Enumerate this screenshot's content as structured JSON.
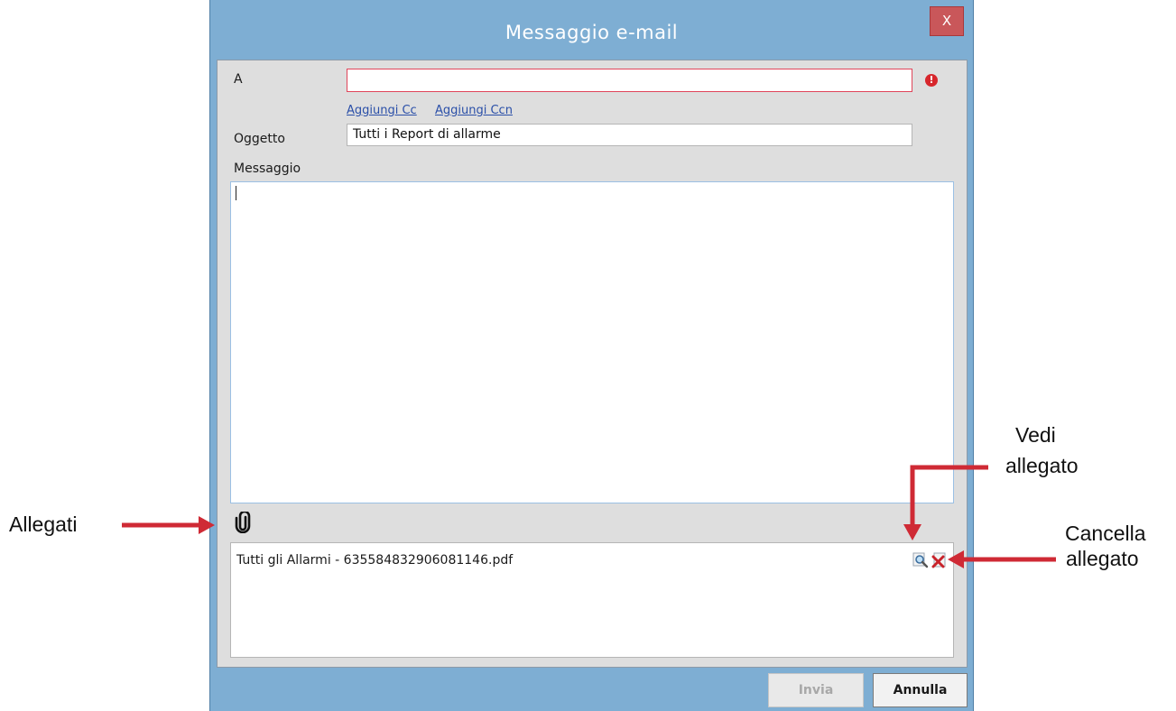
{
  "window": {
    "title": "Messaggio e-mail",
    "close_label": "X"
  },
  "form": {
    "to_label": "A",
    "to_value": "",
    "error_icon_text": "!",
    "add_cc": "Aggiungi Cc",
    "add_bcc": "Aggiungi Ccn",
    "subject_label": "Oggetto",
    "subject_value": "Tutti i Report di allarme",
    "message_label": "Messaggio",
    "message_value": ""
  },
  "attachments": {
    "items": [
      {
        "name": "Tutti gli Allarmi - 635584832906081146.pdf"
      }
    ]
  },
  "buttons": {
    "send_label": "Invia",
    "send_enabled": false,
    "cancel_label": "Annulla"
  },
  "annotations": {
    "attachments_label": "Allegati",
    "view_label_line1": "Vedi",
    "view_label_line2": "allegato",
    "delete_label_line1": "Cancella",
    "delete_label_line2": "allegato"
  },
  "colors": {
    "window_bg": "#7eaed3",
    "close_button": "#c9575a",
    "error": "#d7262c",
    "link": "#2a4fa8",
    "arrow": "#cf2a35"
  },
  "icons": {
    "attachment": "paperclip-icon",
    "view": "magnifier-icon",
    "delete": "delete-file-icon",
    "error": "error-icon"
  }
}
